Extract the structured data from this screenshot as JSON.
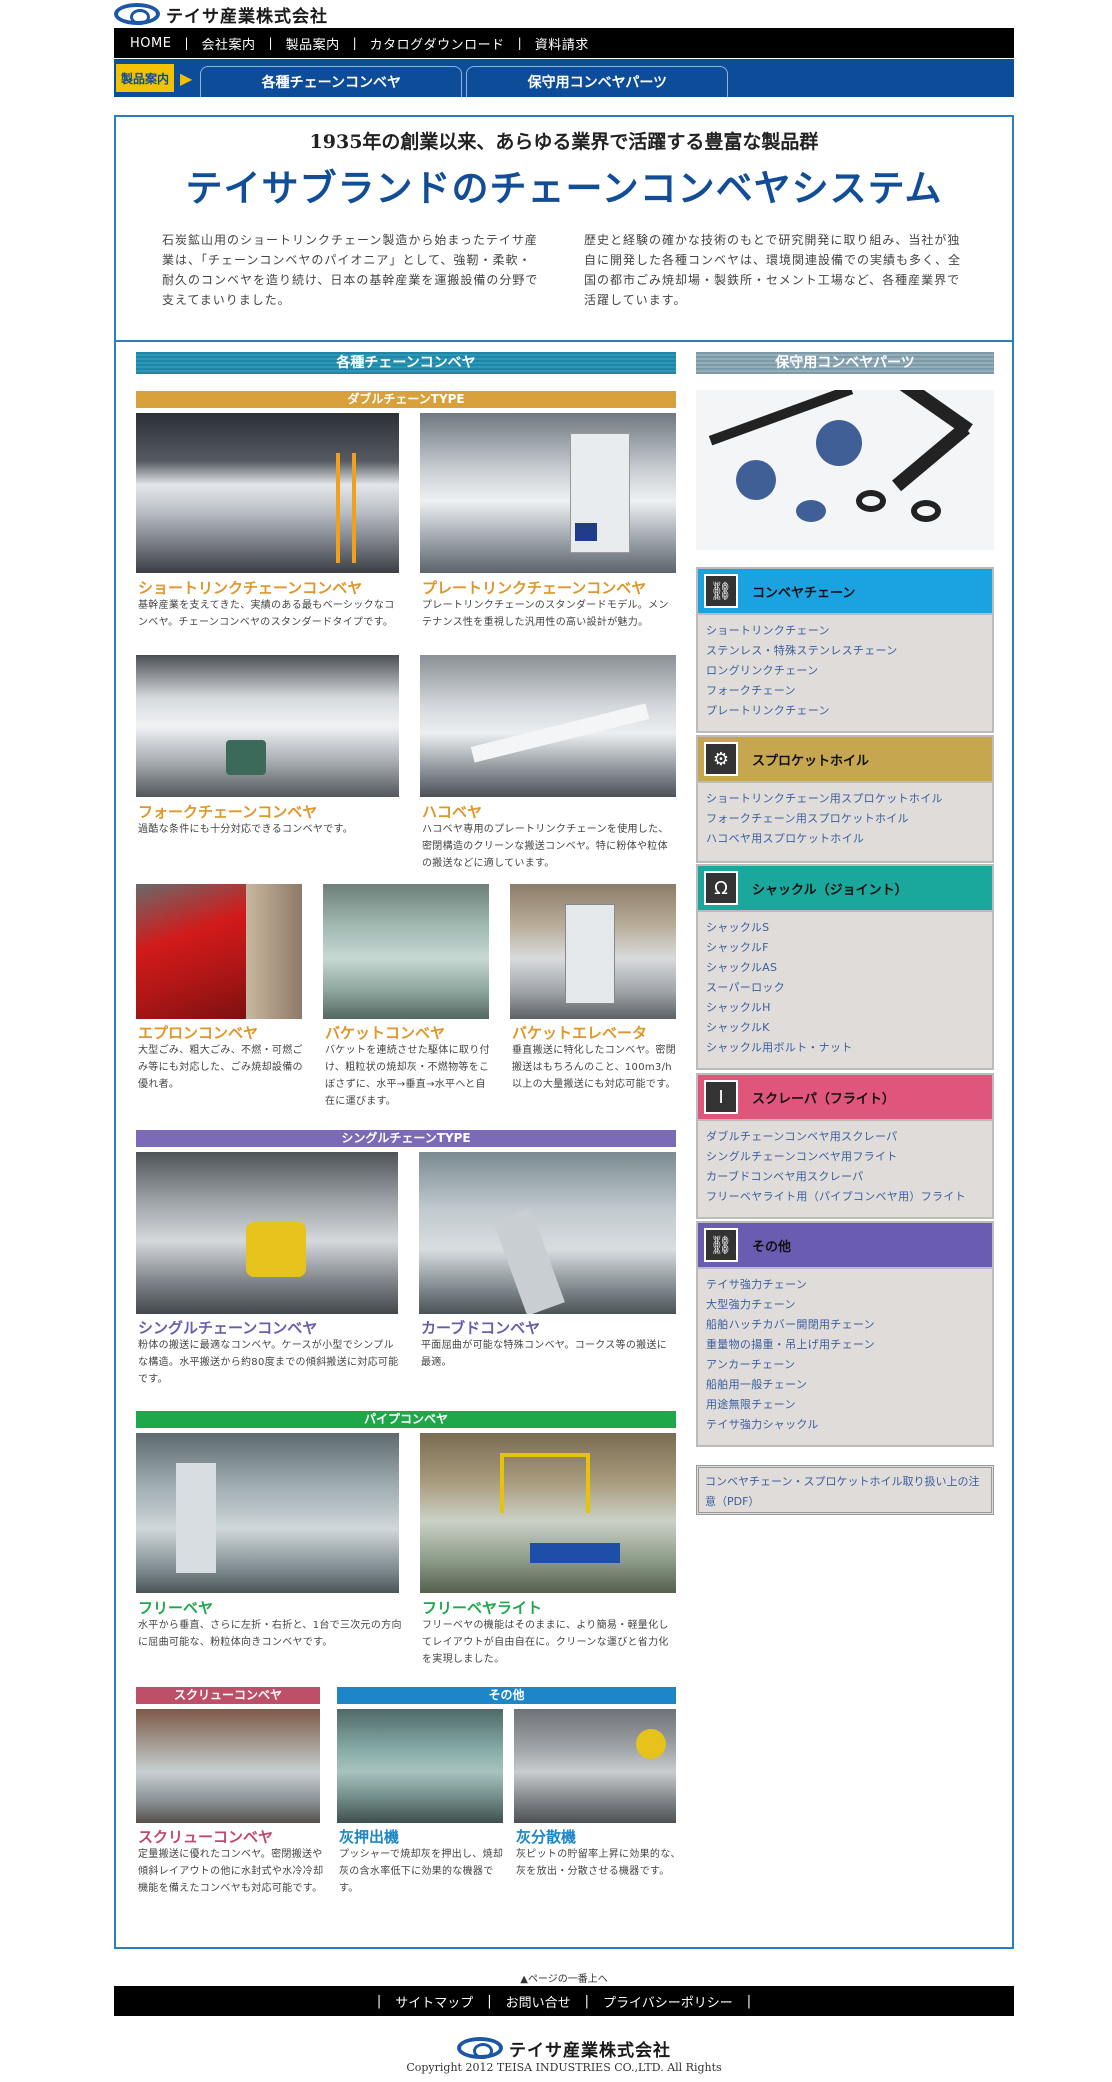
{
  "header": {
    "company": "テイサ産業株式会社",
    "nav": [
      "HOME",
      "会社案内",
      "製品案内",
      "カタログダウンロード",
      "資料請求"
    ],
    "product_label": "製品案内",
    "product_tabs": [
      "各種チェーンコンベヤ",
      "保守用コンベヤパーツ"
    ]
  },
  "intro": {
    "subtitle": "1935年の創業以来、あらゆる業界で活躍する豊富な製品群",
    "title": "テイサブランドのチェーンコンベヤシステム",
    "left_text": "石炭鉱山用のショートリンクチェーン製造から始まったテイサ産業は、「チェーンコンベヤのパイオニア」として、強靭・柔軟・耐久のコンベヤを造り続け、日本の基幹産業を運搬設備の分野で支えてまいりました。",
    "right_text": "歴史と経験の確かな技術のもとで研究開発に取り組み、当社が独自に開発した各種コンベヤは、環境関連設備での実績も多く、全国の都市ごみ焼却場・製鉄所・セメント工場など、各種産業界で活躍しています。"
  },
  "left": {
    "heading": "各種チェーンコンベヤ",
    "double_type": "ダブルチェーンTYPE",
    "single_type": "シングルチェーンTYPE",
    "pipe_type": "パイプコンベヤ",
    "screw_type": "スクリューコンベヤ",
    "other_type": "その他",
    "products": [
      {
        "title": "ショートリンクチェーンコンベヤ",
        "desc": "基幹産業を支えてきた、実績のある最もベーシックなコンベヤ。チェーンコンベヤのスタンダードタイプです。"
      },
      {
        "title": "プレートリンクチェーンコンベヤ",
        "desc": "プレートリンクチェーンのスタンダードモデル。メンテナンス性を重視した汎用性の高い設計が魅力。"
      },
      {
        "title": "フォークチェーンコンベヤ",
        "desc": "過酷な条件にも十分対応できるコンベヤです。"
      },
      {
        "title": "ハコベヤ",
        "desc": "ハコベヤ専用のプレートリンクチェーンを使用した、密閉構造のクリーンな搬送コンベヤ。特に粉体や粒体の搬送などに適しています。"
      },
      {
        "title": "エプロンコンベヤ",
        "desc": "大型ごみ、粗大ごみ、不燃・可燃ごみ等にも対応した、ごみ焼却設備の優れ者。"
      },
      {
        "title": "バケットコンベヤ",
        "desc": "バケットを連続させた駆体に取り付け、粗粒状の焼却灰・不燃物等をこぼさずに、水平→垂直→水平へと自在に運びます。"
      },
      {
        "title": "バケットエレベータ",
        "desc": "垂直搬送に特化したコンベヤ。密閉搬送はもちろんのこと、100m3/h以上の大量搬送にも対応可能です。"
      },
      {
        "title": "シングルチェーンコンベヤ",
        "desc": "粉体の搬送に最適なコンベヤ。ケースが小型でシンプルな構造。水平搬送から約80度までの傾斜搬送に対応可能です。"
      },
      {
        "title": "カーブドコンベヤ",
        "desc": "平面屈曲が可能な特殊コンベヤ。コークス等の搬送に最適。"
      },
      {
        "title": "フリーベヤ",
        "desc": "水平から垂直、さらに左折・右折と、1台で三次元の方向に屈曲可能な、粉粒体向きコンベヤです。"
      },
      {
        "title": "フリーベヤライト",
        "desc": "フリーベヤの機能はそのままに、より簡易・軽量化してレイアウトが自由自在に。クリーンな運びと省力化を実現しました。"
      },
      {
        "title": "スクリューコンベヤ",
        "desc": "定量搬送に優れたコンベヤ。密閉搬送や傾斜レイアウトの他に水封式や水冷冷却機能を備えたコンベヤも対応可能です。"
      },
      {
        "title": "灰押出機",
        "desc": "プッシャーで焼却灰を押出し、焼却灰の含水率低下に効果的な機器です。"
      },
      {
        "title": "灰分散機",
        "desc": "灰ピットの貯留率上昇に効果的な、灰を放出・分散させる機器です。"
      }
    ]
  },
  "right": {
    "heading": "保守用コンベヤパーツ",
    "categories": [
      {
        "name": "コンベヤチェーン",
        "color": "#1aa3e0",
        "icon": "chain-icon",
        "items": [
          "ショートリンクチェーン",
          "ステンレス・特殊ステンレスチェーン",
          "ロングリンクチェーン",
          "フォークチェーン",
          "プレートリンクチェーン"
        ]
      },
      {
        "name": "スプロケットホイル",
        "color": "#c6a64e",
        "icon": "gear-icon",
        "items": [
          "ショートリンクチェーン用スプロケットホイル",
          "フォークチェーン用スプロケットホイル",
          "ハコベヤ用スプロケットホイル"
        ]
      },
      {
        "name": "シャックル（ジョイント）",
        "color": "#1aa89c",
        "icon": "shackle-icon",
        "items": [
          "シャックルS",
          "シャックルF",
          "シャックルAS",
          "スーパーロック",
          "シャックルH",
          "シャックルK",
          "シャックル用ボルト・ナット"
        ]
      },
      {
        "name": "スクレーパ（フライト）",
        "color": "#e0557a",
        "icon": "scraper-icon",
        "items": [
          "ダブルチェーンコンベヤ用スクレーパ",
          "シングルチェーンコンベヤ用フライト",
          "カーブドコンベヤ用スクレーパ",
          "フリーベヤライト用（パイプコンベヤ用）フライト"
        ]
      },
      {
        "name": "その他",
        "color": "#6a5cb0",
        "icon": "chain-icon",
        "items": [
          "テイサ強力チェーン",
          "大型強力チェーン",
          "船舶ハッチカバー開閉用チェーン",
          "重量物の揚重・吊上げ用チェーン",
          "アンカーチェーン",
          "船舶用一般チェーン",
          "用途無限チェーン",
          "テイサ強力シャックル"
        ]
      }
    ],
    "pdf_link": "コンベヤチェーン・スプロケットホイル取り扱い上の注意（PDF）"
  },
  "footer": {
    "page_top": "▲ページの一番上へ",
    "links": [
      "サイトマップ",
      "お問い合せ",
      "プライバシーポリシー"
    ],
    "company": "テイサ産業株式会社",
    "copyright": "Copyright 2012 TEISA INDUSTRIES CO.,LTD. All Rights"
  }
}
